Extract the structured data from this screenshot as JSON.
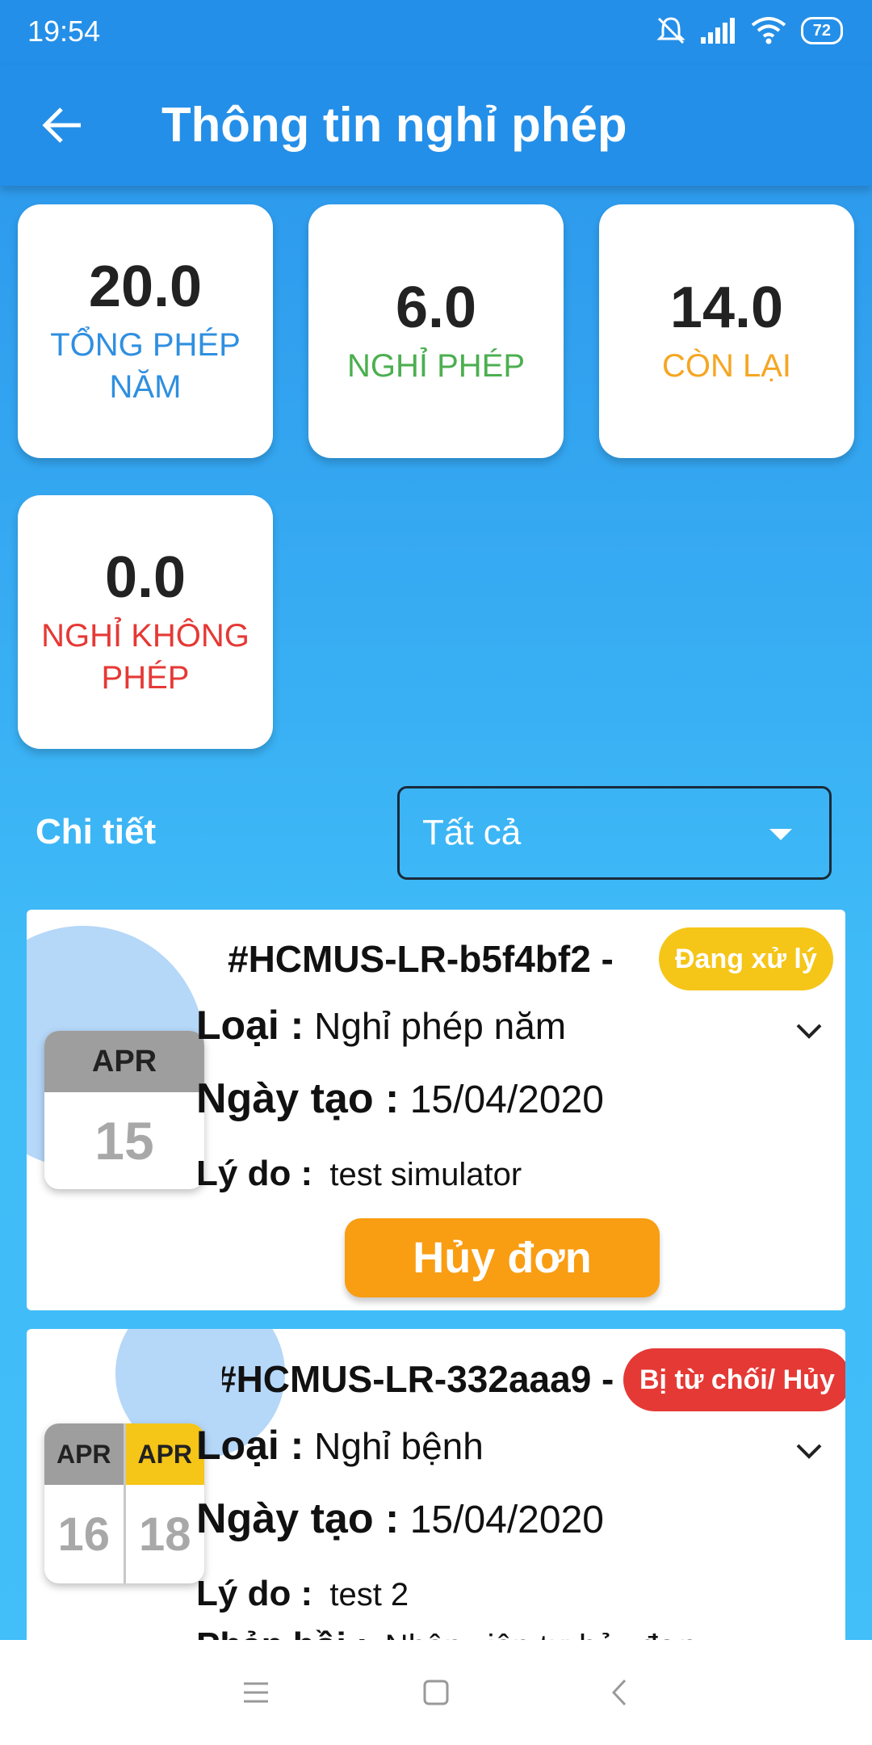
{
  "status_bar": {
    "time": "19:54",
    "battery": "72"
  },
  "app_bar": {
    "title": "Thông tin nghỉ phép"
  },
  "summary": {
    "total": {
      "value": "20.0",
      "label": "TỔNG PHÉP NĂM",
      "color": "#2f8fe0"
    },
    "used": {
      "value": "6.0",
      "label": "NGHỈ PHÉP",
      "color": "#4caf50"
    },
    "remaining": {
      "value": "14.0",
      "label": "CÒN LẠI",
      "color": "#f5a623"
    },
    "unpaid": {
      "value": "0.0",
      "label": "NGHỈ KHÔNG PHÉP",
      "color": "#e53935"
    }
  },
  "details": {
    "label": "Chi tiết",
    "filter_value": "Tất cả"
  },
  "requests": [
    {
      "code": "#HCMUS-LR-b5f4bf2 -",
      "status": "Đang xử lý",
      "status_color": "#f5c518",
      "start_month": "APR",
      "start_day": "15",
      "type_label": "Loại :",
      "type_value": "Nghỉ phép năm",
      "created_label": "Ngày tạo :",
      "created_value": "15/04/2020",
      "reason_label": "Lý do :",
      "reason_value": "test simulator",
      "cancel_label": "Hủy đơn"
    },
    {
      "code": "#HCMUS-LR-332aaa9 -",
      "status": "Bị từ chối/ Hủy",
      "status_color": "#e53935",
      "start_month": "APR",
      "start_day": "16",
      "end_month": "APR",
      "end_day": "18",
      "type_label": "Loại :",
      "type_value": "Nghỉ bệnh",
      "created_label": "Ngày tạo :",
      "created_value": "15/04/2020",
      "reason_label": "Lý do :",
      "reason_value": "test 2",
      "reply_label": "Phản hồi :",
      "reply_value": "Nhân viên tự hủy đơn"
    }
  ],
  "icons": {
    "back": "arrow-left-icon",
    "expand": "chevron-down-icon"
  }
}
